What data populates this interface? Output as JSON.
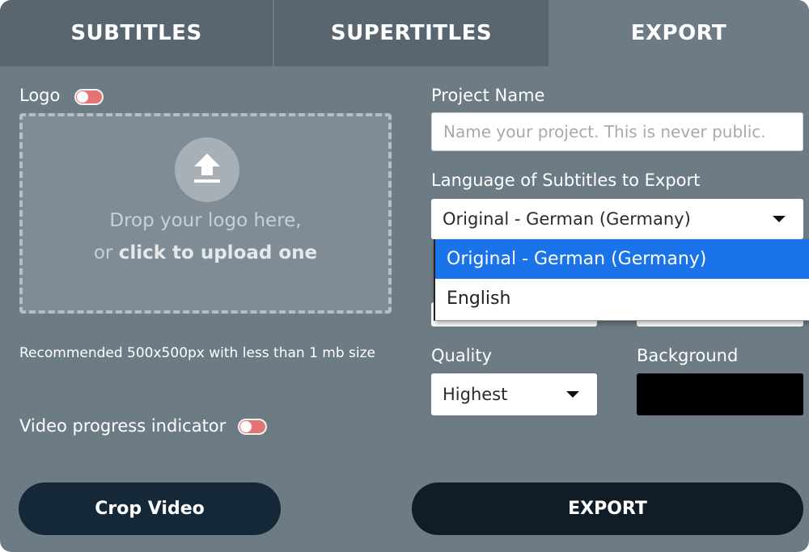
{
  "tabs": [
    {
      "label": "SUBTITLES"
    },
    {
      "label": "SUPERTITLES"
    },
    {
      "label": "EXPORT"
    }
  ],
  "logo": {
    "label": "Logo",
    "toggle_color": "#e57373",
    "dropzone": {
      "icon": "upload-icon",
      "line1": "Drop your logo here,",
      "line2_prefix": "or ",
      "line2_bold": "click to upload one"
    },
    "recommendation": "Recommended 500x500px with less than 1 mb size"
  },
  "progress_indicator": {
    "label": "Video progress indicator"
  },
  "project": {
    "label": "Project Name",
    "placeholder": "Name your project. This is never public."
  },
  "language": {
    "label": "Language of Subtitles to Export",
    "selected": "Original - German (Germany)",
    "options": [
      "Original - German (Germany)",
      "English"
    ]
  },
  "quality": {
    "label": "Quality",
    "selected": "Highest"
  },
  "background": {
    "label": "Background",
    "color": "#000000"
  },
  "buttons": {
    "crop": "Crop Video",
    "export": "EXPORT"
  }
}
